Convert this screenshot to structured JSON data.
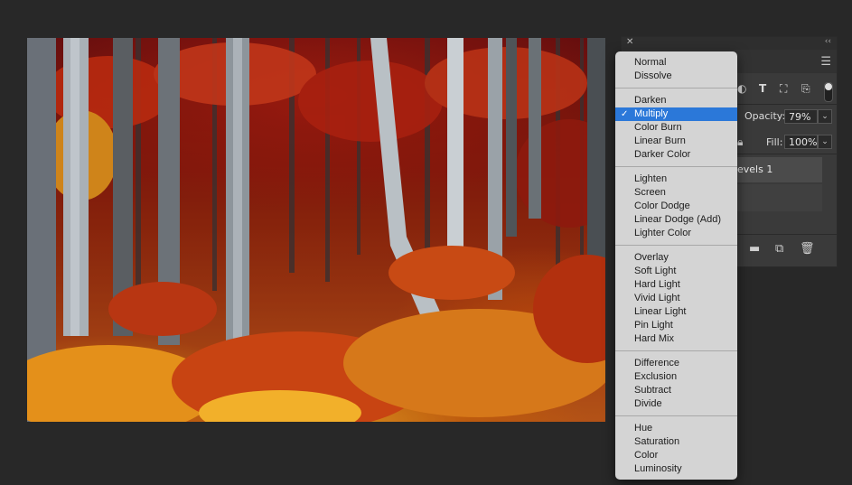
{
  "canvas": {
    "description_icon": "autumn-forest-photo"
  },
  "layers_panel": {
    "close_glyph": "✕",
    "collapse_glyph": "‹‹",
    "menu_glyph": "☰",
    "filter_icons": [
      "adjustment-icon",
      "type-icon",
      "shape-icon",
      "smart-object-icon"
    ],
    "opacity_label": "Opacity:",
    "opacity_value": "79%",
    "fill_label": "Fill:",
    "fill_value": "100%",
    "layer_name": "evels 1",
    "bottom_icons": [
      "folder-icon",
      "new-layer-icon",
      "trash-icon"
    ]
  },
  "blend_menu": {
    "selected": "Multiply",
    "groups": [
      [
        "Normal",
        "Dissolve"
      ],
      [
        "Darken",
        "Multiply",
        "Color Burn",
        "Linear Burn",
        "Darker Color"
      ],
      [
        "Lighten",
        "Screen",
        "Color Dodge",
        "Linear Dodge (Add)",
        "Lighter Color"
      ],
      [
        "Overlay",
        "Soft Light",
        "Hard Light",
        "Vivid Light",
        "Linear Light",
        "Pin Light",
        "Hard Mix"
      ],
      [
        "Difference",
        "Exclusion",
        "Subtract",
        "Divide"
      ],
      [
        "Hue",
        "Saturation",
        "Color",
        "Luminosity"
      ]
    ]
  },
  "colors": {
    "background": "#282828",
    "menu_bg": "#d4d4d4",
    "highlight": "#2b78d9"
  }
}
